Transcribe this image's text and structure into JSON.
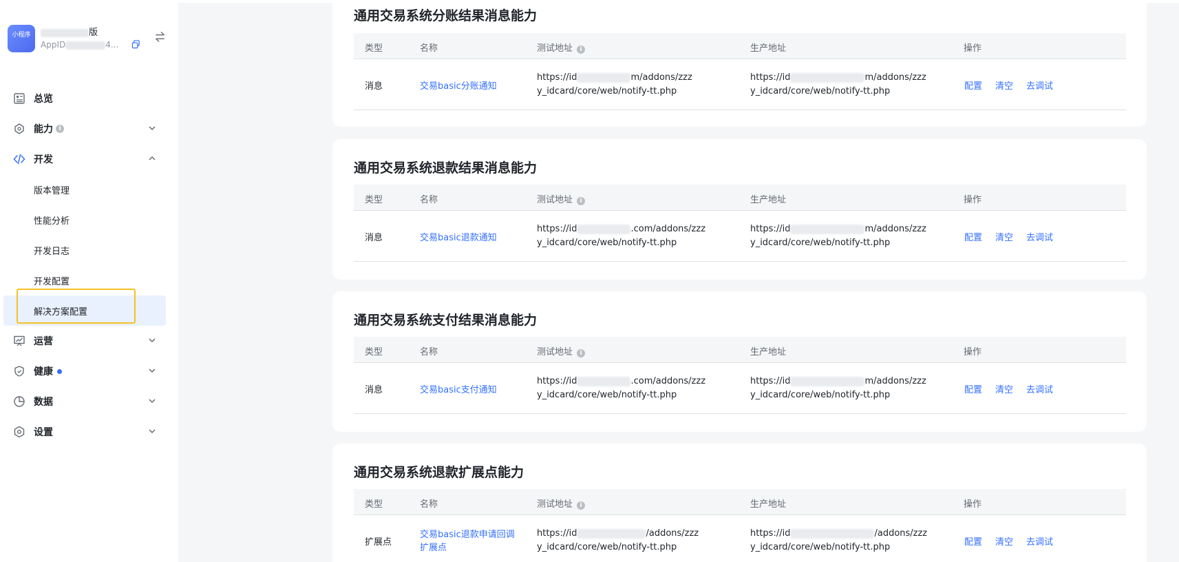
{
  "app": {
    "logo_text": "小程序",
    "name_suffix": "版",
    "id_prefix": "AppID",
    "id_suffix": "4..."
  },
  "nav": {
    "overview": "总览",
    "ability": "能力",
    "develop": "开发",
    "develop_sub": [
      "版本管理",
      "性能分析",
      "开发日志",
      "开发配置",
      "解决方案配置"
    ],
    "operate": "运营",
    "health": "健康",
    "data": "数据",
    "settings": "设置"
  },
  "table_headers": {
    "type": "类型",
    "name": "名称",
    "test_url": "测试地址",
    "prod_url": "生产地址",
    "ops": "操作"
  },
  "ops": {
    "config": "配置",
    "clear": "清空",
    "debug": "去调试"
  },
  "cards": [
    {
      "title": "通用交易系统分账结果消息能力",
      "row": {
        "type": "消息",
        "name": "交易basic分账通知",
        "test_url_a": "https://id",
        "test_url_b": "m/addons/zzz",
        "test_url_line2": "y_idcard/core/web/notify-tt.php",
        "prod_url_a": "https://id",
        "prod_url_b": "m/addons/zzz",
        "prod_url_line2": "y_idcard/core/web/notify-tt.php"
      }
    },
    {
      "title": "通用交易系统退款结果消息能力",
      "row": {
        "type": "消息",
        "name": "交易basic退款通知",
        "test_url_a": "https://id",
        "test_url_b": ".com/addons/zzz",
        "test_url_line2": "y_idcard/core/web/notify-tt.php",
        "prod_url_a": "https://id",
        "prod_url_b": "m/addons/zzz",
        "prod_url_line2": "y_idcard/core/web/notify-tt.php"
      }
    },
    {
      "title": "通用交易系统支付结果消息能力",
      "row": {
        "type": "消息",
        "name": "交易basic支付通知",
        "test_url_a": "https://id",
        "test_url_b": ".com/addons/zzz",
        "test_url_line2": "y_idcard/core/web/notify-tt.php",
        "prod_url_a": "https://id",
        "prod_url_b": "m/addons/zzz",
        "prod_url_line2": "y_idcard/core/web/notify-tt.php"
      }
    },
    {
      "title": "通用交易系统退款扩展点能力",
      "row": {
        "type": "扩展点",
        "name": "交易basic退款申请回调扩展点",
        "test_url_a": "https://id",
        "test_url_b": "/addons/zzz",
        "test_url_line2": "y_idcard/core/web/notify-tt.php",
        "prod_url_a": "https://id",
        "prod_url_b": "/addons/zzz",
        "prod_url_line2": "y_idcard/core/web/notify-tt.php"
      }
    }
  ]
}
